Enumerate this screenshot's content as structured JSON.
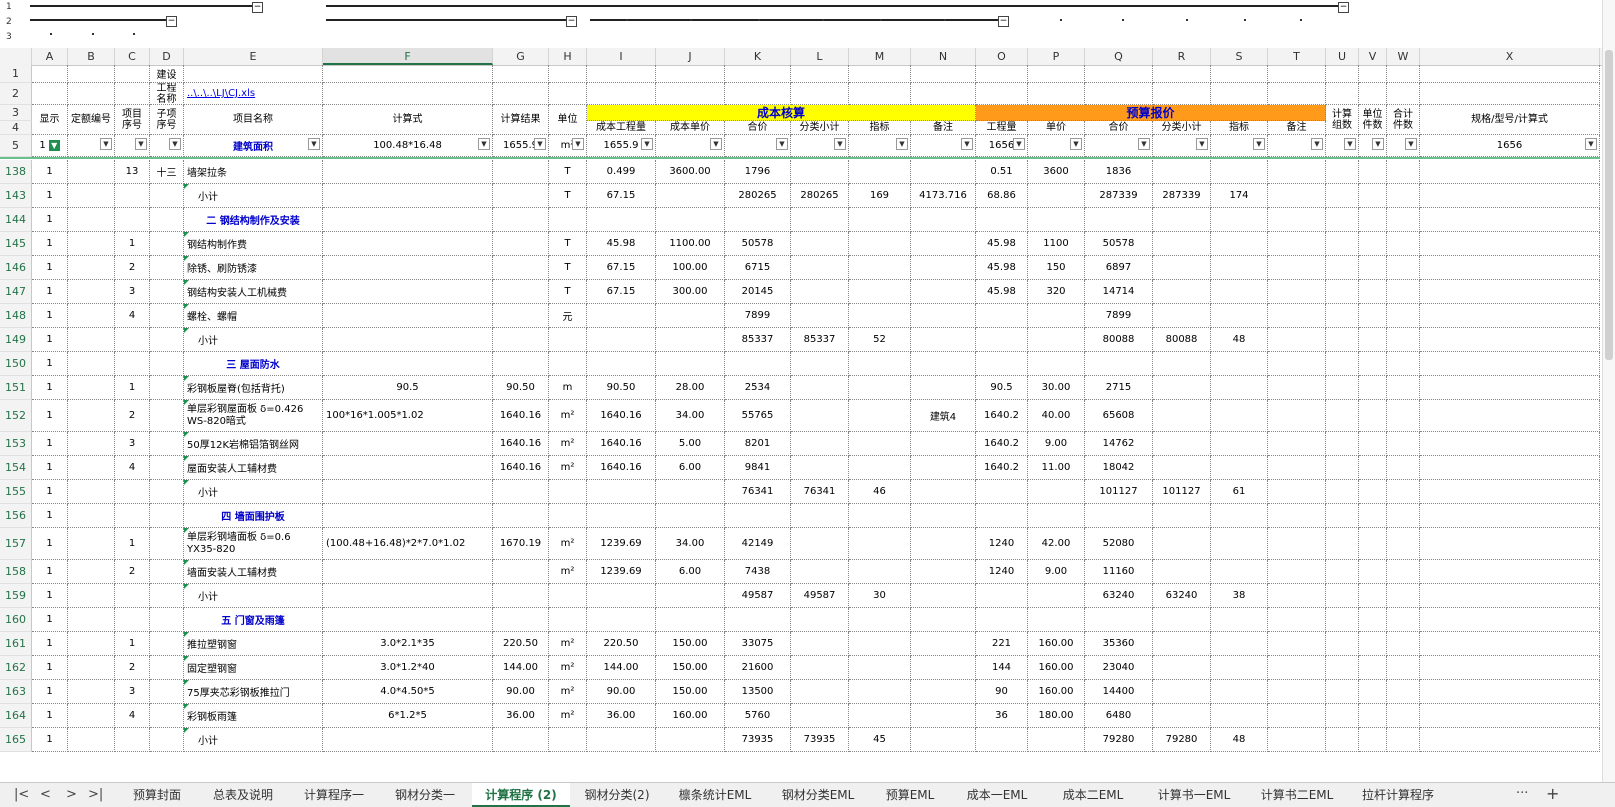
{
  "outline_levels": [
    "1",
    "2",
    "3"
  ],
  "columns": [
    "A",
    "B",
    "C",
    "D",
    "E",
    "F",
    "G",
    "H",
    "I",
    "J",
    "K",
    "L",
    "M",
    "N",
    "O",
    "P",
    "Q",
    "R",
    "S",
    "T",
    "U",
    "V",
    "W",
    "X"
  ],
  "selected_column": "F",
  "header_rows": {
    "r1": {
      "num": "1",
      "d": "建设",
      "e": ""
    },
    "r2": {
      "num": "2",
      "d": "工程名称",
      "e": "..\\..\\..\\LJ\\CJ.xls"
    },
    "r3num": "3",
    "r4num": "4",
    "a": "显示",
    "b": "定额编号",
    "c": "项目序号",
    "d": "子项序号",
    "e": "项目名称",
    "f": "计算式",
    "g": "计算结果",
    "h": "单位",
    "cost_group": "成本核算",
    "quote_group": "预算报价",
    "i": "成本工程量",
    "j": "成本单价",
    "k": "合价",
    "l": "分类小计",
    "m": "指标",
    "n": "备注",
    "o": "工程量",
    "p": "单价",
    "q": "合价",
    "r": "分类小计",
    "s": "指标",
    "t": "备注",
    "u": "计算组数",
    "v": "单位件数",
    "w": "合计件数",
    "x": "规格/型号/计算式"
  },
  "row5": {
    "num": "5",
    "a": "1",
    "e": "建筑面积",
    "f": "100.48*16.48",
    "g": "1655.9",
    "h": "m²",
    "i": "1655.9",
    "o": "1656",
    "x": "1656"
  },
  "rows": [
    {
      "num": "138",
      "a": "1",
      "c": "13",
      "d": "十三",
      "e": "墙架拉条",
      "h": "T",
      "i": "0.499",
      "j": "3600.00",
      "k": "1796",
      "o": "0.51",
      "p": "3600",
      "q": "1836"
    },
    {
      "num": "143",
      "a": "1",
      "e": "小计",
      "ind": true,
      "h": "T",
      "i": "67.15",
      "k": "280265",
      "l": "280265",
      "m": "169",
      "n": "4173.716",
      "o": "68.86",
      "q": "287339",
      "r": "287339",
      "s": "174"
    },
    {
      "num": "144",
      "a": "1",
      "e": "二  钢结构制作及安装",
      "sec": true
    },
    {
      "num": "145",
      "a": "1",
      "c": "1",
      "e": "钢结构制作费",
      "h": "T",
      "i": "45.98",
      "j": "1100.00",
      "k": "50578",
      "o": "45.98",
      "p": "1100",
      "q": "50578"
    },
    {
      "num": "146",
      "a": "1",
      "c": "2",
      "e": "除锈、刷防锈漆",
      "h": "T",
      "i": "67.15",
      "j": "100.00",
      "k": "6715",
      "o": "45.98",
      "p": "150",
      "q": "6897"
    },
    {
      "num": "147",
      "a": "1",
      "c": "3",
      "e": "钢结构安装人工机械费",
      "h": "T",
      "i": "67.15",
      "j": "300.00",
      "k": "20145",
      "o": "45.98",
      "p": "320",
      "q": "14714"
    },
    {
      "num": "148",
      "a": "1",
      "c": "4",
      "e": "螺栓、螺帽",
      "h": "元",
      "k": "7899",
      "q": "7899"
    },
    {
      "num": "149",
      "a": "1",
      "e": "小计",
      "ind": true,
      "k": "85337",
      "l": "85337",
      "m": "52",
      "q": "80088",
      "r": "80088",
      "s": "48"
    },
    {
      "num": "150",
      "a": "1",
      "e": "三  屋面防水",
      "sec": true
    },
    {
      "num": "151",
      "a": "1",
      "c": "1",
      "e": "彩钢板屋脊(包括背托)",
      "f": "90.5",
      "g": "90.50",
      "h": "m",
      "i": "90.50",
      "j": "28.00",
      "k": "2534",
      "o": "90.5",
      "p": "30.00",
      "q": "2715"
    },
    {
      "num": "152",
      "a": "1",
      "c": "2",
      "e": "单层彩钢屋面板 δ=0.426 WS-820暗式",
      "f": "100*16*1.005*1.02",
      "fl": true,
      "g": "1640.16",
      "h": "m²",
      "i": "1640.16",
      "j": "34.00",
      "k": "55765",
      "n": "建筑4",
      "o": "1640.2",
      "p": "40.00",
      "q": "65608",
      "tall": true
    },
    {
      "num": "153",
      "a": "1",
      "c": "3",
      "e": "50厚12K岩棉铝箔钢丝网",
      "g": "1640.16",
      "h": "m²",
      "i": "1640.16",
      "j": "5.00",
      "k": "8201",
      "o": "1640.2",
      "p": "9.00",
      "q": "14762"
    },
    {
      "num": "154",
      "a": "1",
      "c": "4",
      "e": "屋面安装人工辅材费",
      "g": "1640.16",
      "h": "m²",
      "i": "1640.16",
      "j": "6.00",
      "k": "9841",
      "o": "1640.2",
      "p": "11.00",
      "q": "18042"
    },
    {
      "num": "155",
      "a": "1",
      "e": "小计",
      "ind": true,
      "k": "76341",
      "l": "76341",
      "m": "46",
      "q": "101127",
      "r": "101127",
      "s": "61"
    },
    {
      "num": "156",
      "a": "1",
      "e": "四  墙面围护板",
      "sec": true
    },
    {
      "num": "157",
      "a": "1",
      "c": "1",
      "e": "单层彩钢墙面板 δ=0.6 YX35-820",
      "f": "(100.48+16.48)*2*7.0*1.02",
      "fl": true,
      "g": "1670.19",
      "h": "m²",
      "i": "1239.69",
      "j": "34.00",
      "k": "42149",
      "o": "1240",
      "p": "42.00",
      "q": "52080",
      "tall": true
    },
    {
      "num": "158",
      "a": "1",
      "c": "2",
      "e": "墙面安装人工辅材费",
      "h": "m²",
      "i": "1239.69",
      "j": "6.00",
      "k": "7438",
      "o": "1240",
      "p": "9.00",
      "q": "11160"
    },
    {
      "num": "159",
      "a": "1",
      "e": "小计",
      "ind": true,
      "k": "49587",
      "l": "49587",
      "m": "30",
      "q": "63240",
      "r": "63240",
      "s": "38"
    },
    {
      "num": "160",
      "a": "1",
      "e": "五  门窗及雨篷",
      "sec": true
    },
    {
      "num": "161",
      "a": "1",
      "c": "1",
      "e": "推拉塑钢窗",
      "f": "3.0*2.1*35",
      "g": "220.50",
      "h": "m²",
      "i": "220.50",
      "j": "150.00",
      "k": "33075",
      "o": "221",
      "p": "160.00",
      "q": "35360"
    },
    {
      "num": "162",
      "a": "1",
      "c": "2",
      "e": "固定塑钢窗",
      "f": "3.0*1.2*40",
      "g": "144.00",
      "h": "m²",
      "i": "144.00",
      "j": "150.00",
      "k": "21600",
      "o": "144",
      "p": "160.00",
      "q": "23040"
    },
    {
      "num": "163",
      "a": "1",
      "c": "3",
      "e": "75厚夹芯彩钢板推拉门",
      "f": "4.0*4.50*5",
      "g": "90.00",
      "h": "m²",
      "i": "90.00",
      "j": "150.00",
      "k": "13500",
      "o": "90",
      "p": "160.00",
      "q": "14400"
    },
    {
      "num": "164",
      "a": "1",
      "c": "4",
      "e": "彩钢板雨篷",
      "f": "6*1.2*5",
      "g": "36.00",
      "h": "m²",
      "i": "36.00",
      "j": "160.00",
      "k": "5760",
      "o": "36",
      "p": "180.00",
      "q": "6480"
    },
    {
      "num": "165",
      "a": "1",
      "e": "小计",
      "ind": true,
      "k": "73935",
      "l": "73935",
      "m": "45",
      "q": "79280",
      "r": "79280",
      "s": "48"
    }
  ],
  "sheet_tabs": [
    "预算封面",
    "总表及说明",
    "计算程序一",
    "钢材分类一",
    "计算程序 (2)",
    "钢材分类(2)",
    "檩条统计EML",
    "钢材分类EML",
    "预算EML",
    "成本一EML",
    "成本二EML",
    "计算书一EML",
    "计算书二EML",
    "拉杆计算程序"
  ],
  "active_tab": "计算程序 (2)",
  "tab_more": "···",
  "tab_add": "+",
  "nav": [
    "|<",
    "<",
    ">",
    ">|"
  ],
  "colors": {
    "accent": "#217346",
    "yellow": "#ffff00",
    "orange": "#ff9a1a",
    "section_text": "#0000cc"
  }
}
